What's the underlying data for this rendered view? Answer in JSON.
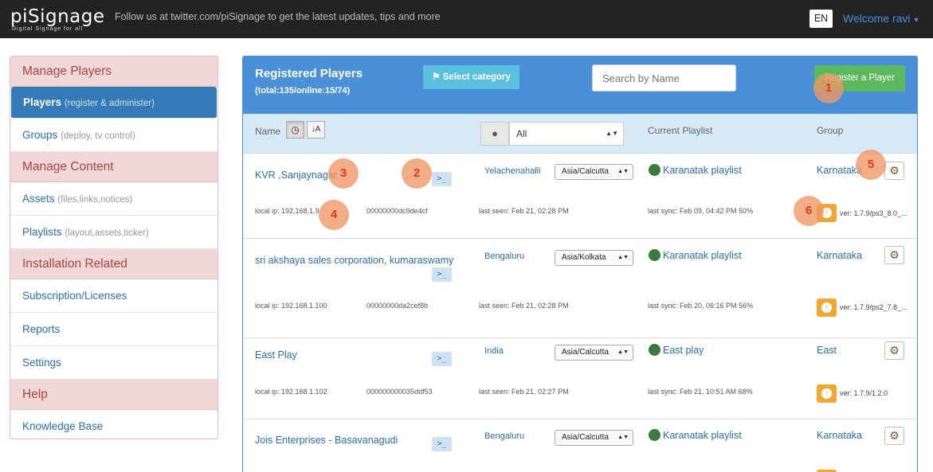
{
  "header": {
    "logo": "piSignage",
    "logo_sub": "Digital Signage for all",
    "tagline": "Follow us at twitter.com/piSignage to get the latest updates, tips and more",
    "lang": "EN",
    "welcome": "Welcome ravi"
  },
  "sidebar": {
    "sections": [
      {
        "title": "Manage Players",
        "items": [
          {
            "label": "Players",
            "sub": "(register & administer)"
          },
          {
            "label": "Groups",
            "sub": "(deploy, tv control)"
          }
        ]
      },
      {
        "title": "Manage Content",
        "items": [
          {
            "label": "Assets",
            "sub": "(files,links,notices)"
          },
          {
            "label": "Playlists",
            "sub": "(layout,assets,ticker)"
          }
        ]
      },
      {
        "title": "Installation Related",
        "items": [
          {
            "label": "Subscription/Licenses",
            "sub": ""
          },
          {
            "label": "Reports",
            "sub": ""
          },
          {
            "label": "Settings",
            "sub": ""
          }
        ]
      },
      {
        "title": "Help",
        "items": [
          {
            "label": "Knowledge Base",
            "sub": ""
          }
        ]
      }
    ]
  },
  "panel": {
    "title": "Registered Players",
    "count": "(total:135/online:15/74)",
    "select_category": "Select category",
    "search_placeholder": "Search by Name",
    "register_button": "Register a Player",
    "col_name": "Name",
    "location_filter": "All",
    "col_playlist": "Current Playlist",
    "col_group": "Group"
  },
  "players": [
    {
      "name": "KVR ,Sanjaynagar",
      "location": "Yelachenahalli",
      "timezone": "Asia/Calcutta",
      "playlist": "Karanatak playlist",
      "group": "Karnataka",
      "ip": "local ip:  192.168.1.9",
      "cpu": "00000000dc9de4cf",
      "last_seen": "last seen:  Feb 21, 02:28 PM",
      "last_sync": "last sync:  Feb 09, 04:42 PM 50%",
      "version": "ver: 1.7.9/ps3_8.0_..."
    },
    {
      "name": "sri akshaya sales corporation, kumaraswamy la...",
      "location": "Bengaluru",
      "timezone": "Asia/Kolkata",
      "playlist": "Karanatak playlist",
      "group": "Karnataka",
      "ip": "local ip:  192.168.1.100",
      "cpu": "00000000da2cef8b",
      "last_seen": "last seen:  Feb 21, 02:28 PM",
      "last_sync": "last sync:  Feb 20, 06:16 PM 56%",
      "version": "ver: 1.7.9/ps2_7.8_..."
    },
    {
      "name": "East Play",
      "location": "India",
      "timezone": "Asia/Calcutta",
      "playlist": "East play",
      "group": "East",
      "ip": "local ip:  192.168.1.102",
      "cpu": "000000000035ddf53",
      "last_seen": "last seen:  Feb 21, 02:27 PM",
      "last_sync": "last sync:  Feb 21, 10:51 AM 68%",
      "version": "ver: 1.7.9/1.2.0"
    },
    {
      "name": "Jois Enterprises - Basavanagudi",
      "location": "Bengaluru",
      "timezone": "Asia/Calcutta",
      "playlist": "Karanatak playlist",
      "group": "Karnataka",
      "ip": "",
      "cpu": "",
      "last_seen": "",
      "last_sync": "",
      "version": ""
    }
  ],
  "terminal_glyph": ">_",
  "badges": [
    "1",
    "2",
    "3",
    "4",
    "5",
    "6"
  ],
  "icons": {
    "tag": "tag-icon",
    "clock": "clock-icon",
    "sort_az": "sort-alpha-icon",
    "map_marker": "map-marker-icon",
    "gear": "gear-icon",
    "upload": "upload-icon",
    "terminal": "terminal-icon"
  },
  "colors": {
    "primary": "#4a90d9",
    "success": "#5cb85c",
    "info": "#5bc0de",
    "warning": "#f0a830",
    "sidebar_head": "#f0d8d9"
  }
}
